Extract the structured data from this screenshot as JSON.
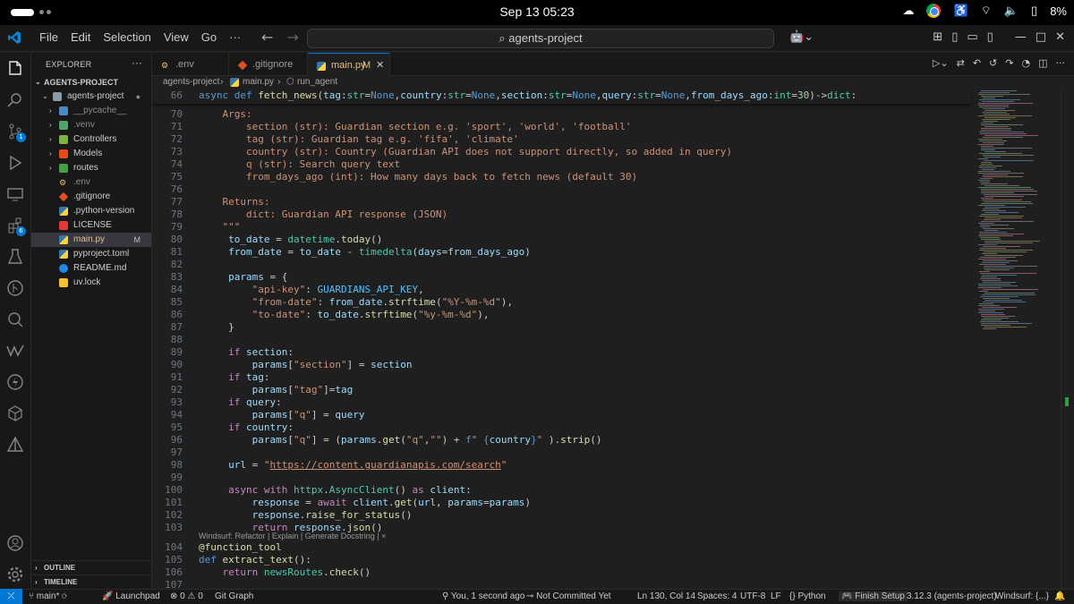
{
  "os": {
    "clock": "Sep 13  05:23",
    "battery": "8%"
  },
  "titlebar": {
    "menu": [
      "File",
      "Edit",
      "Selection",
      "View",
      "Go",
      "···"
    ],
    "search": "agents-project"
  },
  "sidebar": {
    "header": "EXPLORER",
    "root": "AGENTS-PROJECT",
    "folder": "agents-project",
    "items": [
      {
        "label": "__pycache__",
        "kind": "folder"
      },
      {
        "label": ".venv",
        "kind": "folder"
      },
      {
        "label": "Controllers",
        "kind": "folder"
      },
      {
        "label": "Models",
        "kind": "folder"
      },
      {
        "label": "routes",
        "kind": "folder"
      },
      {
        "label": ".env",
        "kind": "file"
      },
      {
        "label": ".gitignore",
        "kind": "file"
      },
      {
        "label": ".python-version",
        "kind": "file"
      },
      {
        "label": "LICENSE",
        "kind": "file"
      },
      {
        "label": "main.py",
        "kind": "file",
        "mark": "M"
      },
      {
        "label": "pyproject.toml",
        "kind": "file"
      },
      {
        "label": "README.md",
        "kind": "file"
      },
      {
        "label": "uv.lock",
        "kind": "file"
      }
    ],
    "outline": "OUTLINE",
    "timeline": "TIMELINE"
  },
  "tabs": [
    {
      "label": ".env"
    },
    {
      "label": ".gitignore"
    },
    {
      "label": "main.py",
      "mark": "M"
    }
  ],
  "breadcrumb": [
    "agents-project",
    "main.py",
    "run_agent"
  ],
  "editor": {
    "sticky_number": "66",
    "lines": [
      {
        "n": "70"
      },
      {
        "n": "71"
      },
      {
        "n": "72"
      },
      {
        "n": "73"
      },
      {
        "n": "74"
      },
      {
        "n": "75"
      },
      {
        "n": "76"
      },
      {
        "n": "77"
      },
      {
        "n": "78"
      },
      {
        "n": "79"
      },
      {
        "n": "80"
      },
      {
        "n": "81"
      },
      {
        "n": "82"
      },
      {
        "n": "83"
      },
      {
        "n": "84"
      },
      {
        "n": "85"
      },
      {
        "n": "86"
      },
      {
        "n": "87"
      },
      {
        "n": "88"
      },
      {
        "n": "89"
      },
      {
        "n": "90"
      },
      {
        "n": "91"
      },
      {
        "n": "92"
      },
      {
        "n": "93"
      },
      {
        "n": "94"
      },
      {
        "n": "95"
      },
      {
        "n": "96"
      },
      {
        "n": "97"
      },
      {
        "n": "98"
      },
      {
        "n": "99"
      },
      {
        "n": "100"
      },
      {
        "n": "101"
      },
      {
        "n": "102"
      },
      {
        "n": "103"
      },
      {
        "n": "104"
      },
      {
        "n": "105"
      },
      {
        "n": "106"
      },
      {
        "n": "107"
      }
    ],
    "codelens": "Windsurf: Refactor | Explain | Generate Docstring | ×"
  },
  "statusbar": {
    "branch": "main*",
    "launchpad": "Launchpad",
    "problems": "⊗ 0 ⚠ 0",
    "gitgraph": "Git Graph",
    "blame": "You, 1 second ago",
    "commit": "Not Committed Yet",
    "position": "Ln 130, Col 14",
    "spaces": "Spaces: 4",
    "encoding": "UTF-8",
    "eol": "LF",
    "language": "{} Python",
    "finish": "Finish Setup",
    "interpreter": "3.12.3 (agents-project)",
    "windsurf": "Windsurf: {...}"
  },
  "colors": {
    "accent": "#0078d4",
    "modified": "#e2c08d",
    "keyword": "#569cd6",
    "string": "#ce9178",
    "function": "#dcdcaa"
  }
}
